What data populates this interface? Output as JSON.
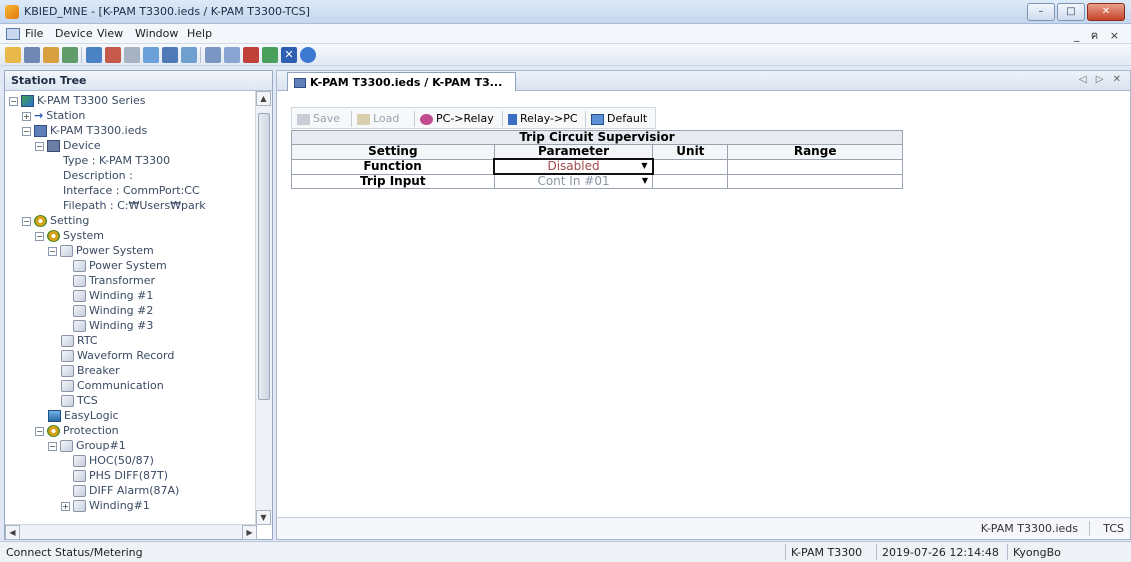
{
  "window": {
    "title": "KBIED_MNE - [K-PAM T3300.ieds / K-PAM T3300-TCS]",
    "controls": {
      "minimize": "–",
      "maximize": "□",
      "close": "✕"
    }
  },
  "menu": {
    "items": [
      "File",
      "Device",
      "View",
      "Window",
      "Help"
    ],
    "mdi_controls": "_ ฅ ×"
  },
  "toolbar": {
    "icons": [
      "open-icon",
      "save-icon",
      "connect-icon",
      "network-icon",
      "upload-icon",
      "download-icon",
      "settings-icon",
      "refresh-icon",
      "monitor-icon",
      "table-icon",
      "window-icon",
      "link-icon",
      "unlink-icon",
      "transfer-icon",
      "delete-icon",
      "help-icon"
    ]
  },
  "tree": {
    "header": "Station Tree",
    "nodes": [
      {
        "label": "K-PAM T3300 Series",
        "icon": "series",
        "expander": "−"
      },
      {
        "label": "Station",
        "icon": "arrow",
        "expander": "+"
      },
      {
        "label": "K-PAM T3300.ieds",
        "icon": "ied",
        "expander": "−"
      },
      {
        "label": "Device",
        "icon": "device",
        "expander": "−"
      },
      {
        "label": "Type : K-PAM T3300"
      },
      {
        "label": "Description :"
      },
      {
        "label": "Interface : CommPort:CC"
      },
      {
        "label": "Filepath : C:₩Users₩park"
      },
      {
        "label": "Setting",
        "icon": "gear",
        "expander": "−"
      },
      {
        "label": "System",
        "icon": "gear",
        "expander": "−"
      },
      {
        "label": "Power System",
        "icon": "doc",
        "expander": "−"
      },
      {
        "label": "Power System",
        "icon": "doc"
      },
      {
        "label": "Transformer",
        "icon": "doc"
      },
      {
        "label": "Winding #1",
        "icon": "doc"
      },
      {
        "label": "Winding #2",
        "icon": "doc"
      },
      {
        "label": "Winding #3",
        "icon": "doc"
      },
      {
        "label": "RTC",
        "icon": "doc"
      },
      {
        "label": "Waveform Record",
        "icon": "doc"
      },
      {
        "label": "Breaker",
        "icon": "doc"
      },
      {
        "label": "Communication",
        "icon": "doc"
      },
      {
        "label": "TCS",
        "icon": "doc"
      },
      {
        "label": "EasyLogic",
        "icon": "easy"
      },
      {
        "label": "Protection",
        "icon": "gear",
        "expander": "−"
      },
      {
        "label": "Group#1",
        "icon": "doc",
        "expander": "−"
      },
      {
        "label": "HOC(50/87)",
        "icon": "doc"
      },
      {
        "label": "PHS DIFF(87T)",
        "icon": "doc"
      },
      {
        "label": "DIFF Alarm(87A)",
        "icon": "doc"
      },
      {
        "label": "Winding#1",
        "icon": "doc",
        "expander": "+"
      }
    ]
  },
  "document": {
    "tab_label": "K-PAM T3300.ieds / K-PAM T3...",
    "nav": "◁ ▷ ✕",
    "toolbar": {
      "save": "Save",
      "load": "Load",
      "pc_to_relay": "PC->Relay",
      "relay_to_pc": "Relay->PC",
      "default": "Default"
    },
    "grid": {
      "caption": "Trip Circuit Supervisior",
      "headers": [
        "Setting",
        "Parameter",
        "Unit",
        "Range"
      ],
      "rows": [
        {
          "setting": "Function",
          "parameter": "Disabled",
          "unit": "",
          "range": ""
        },
        {
          "setting": "Trip Input",
          "parameter": "Cont In #01",
          "unit": "",
          "range": ""
        }
      ]
    },
    "footer": {
      "file": "K-PAM T3300.ieds",
      "page": "TCS"
    }
  },
  "status": {
    "left": "Connect Status/Metering",
    "device": "K-PAM T3300",
    "datetime": "2019-07-26 12:14:48",
    "user": "KyongBo"
  },
  "colors": {
    "accent": "#2e6fd0",
    "disabled_value": "#a0494a"
  }
}
